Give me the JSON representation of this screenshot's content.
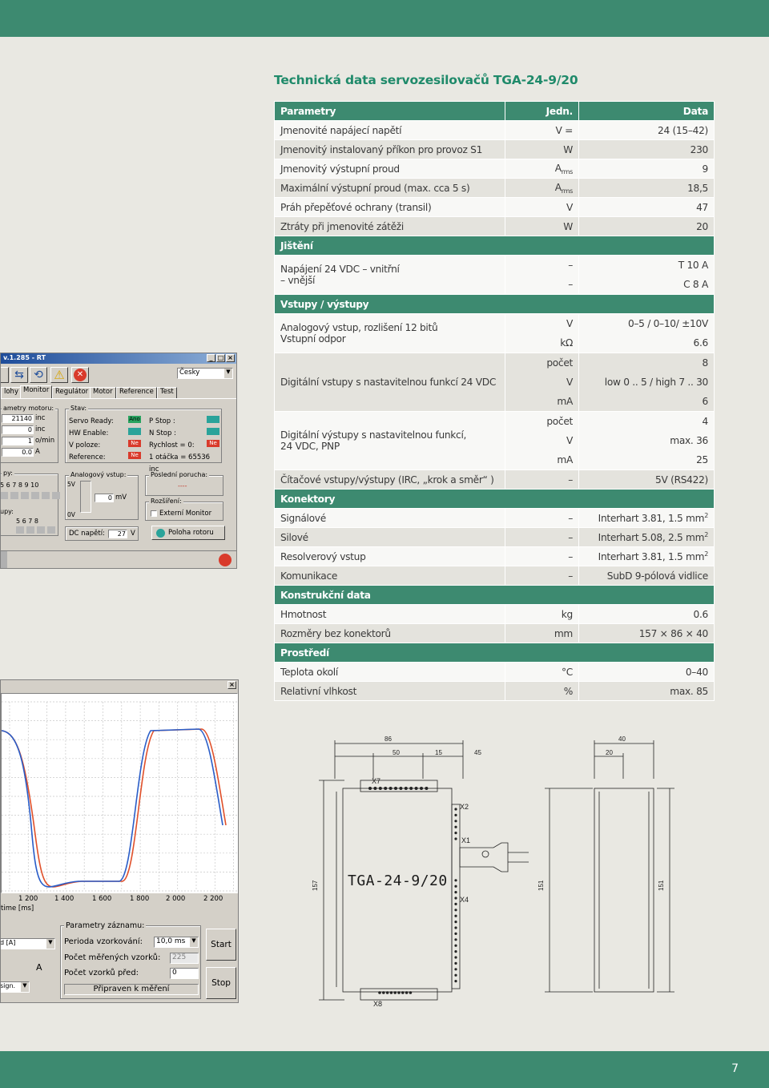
{
  "page": {
    "title": "Technická data servozesilovačů TGA-24-9/20",
    "page_number": "7",
    "colors": {
      "brand_green": "#3d8a70",
      "title_green": "#1f8a6a",
      "background": "#e9e8e2"
    }
  },
  "table": {
    "header": {
      "param": "Parametry",
      "unit": "Jedn.",
      "value": "Data"
    },
    "rows_power": [
      {
        "param": "Jmenovité napájecí napětí",
        "unit": "V =",
        "value": "24 (15–42)"
      },
      {
        "param": "Jmenovitý instalovaný příkon pro provoz S1",
        "unit": "W",
        "value": "230"
      },
      {
        "param": "Jmenovitý výstupní proud",
        "unit": "A",
        "unit_sub": "rms",
        "value": "9"
      },
      {
        "param": "Maximální výstupní proud (max. cca 5 s)",
        "unit": "A",
        "unit_sub": "rms",
        "value": "18,5"
      },
      {
        "param": "Práh přepěťové ochrany (transil)",
        "unit": "V",
        "value": "47"
      },
      {
        "param": "Ztráty při jmenovité zátěži",
        "unit": "W",
        "value": "20"
      }
    ],
    "sec_protection": "Jištění",
    "protection": {
      "param_line1": "Napájení 24 VDC – vnitřní",
      "param_line2": "– vnější",
      "unit1": "–",
      "value1": "T 10 A",
      "unit2": "–",
      "value2": "C 8 A"
    },
    "sec_io": "Vstupy / výstupy",
    "io_analog": {
      "param_line1": "Analogový vstup, rozlišení 12 bitů",
      "param_line2": "Vstupní odpor",
      "unit1": "V",
      "value1": "0–5 / 0–10/ ±10V",
      "unit2": "kΩ",
      "value2": "6.6"
    },
    "io_digital_in": {
      "param": "Digitální vstupy s nastavitelnou funkcí 24 VDC",
      "unit1": "počet",
      "value1": "8",
      "unit2": "V",
      "value2": "low 0 .. 5 / high 7 .. 30",
      "unit3": "mA",
      "value3": "6"
    },
    "io_digital_out": {
      "param_line1": "Digitální výstupy s nastavitelnou funkcí,",
      "param_line2": "24 VDC, PNP",
      "unit1": "počet",
      "value1": "4",
      "unit2": "V",
      "value2": "max. 36",
      "unit3": "mA",
      "value3": "25"
    },
    "io_counter": {
      "param": "Čítačové vstupy/výstupy (IRC, „krok a směr“ )",
      "unit": "–",
      "value": "5V (RS422)"
    },
    "sec_connectors": "Konektory",
    "connectors": [
      {
        "param": "Signálové",
        "unit": "–",
        "value": "Interhart 3.81, 1.5 mm",
        "sup": "2"
      },
      {
        "param": "Silové",
        "unit": "–",
        "value": "Interhart 5.08, 2.5 mm",
        "sup": "2"
      },
      {
        "param": "Resolverový vstup",
        "unit": "–",
        "value": "Interhart 3.81, 1.5 mm",
        "sup": "2"
      },
      {
        "param": "Komunikace",
        "unit": "–",
        "value": "SubD 9-pólová vidlice"
      }
    ],
    "sec_construction": "Konstrukční data",
    "construction": [
      {
        "param": "Hmotnost",
        "unit": "kg",
        "value": "0.6"
      },
      {
        "param": "Rozměry bez konektorů",
        "unit": "mm",
        "value": "157 × 86 × 40"
      }
    ],
    "sec_environment": "Prostředí",
    "environment": [
      {
        "param": "Teplota okolí",
        "unit": "°C",
        "value": "0–40"
      },
      {
        "param": "Relativní vlhkost",
        "unit": "%",
        "value": "max. 85"
      }
    ]
  },
  "software1": {
    "title": "v.1.285 - RT",
    "language": "Česky",
    "tabs": [
      "lohy",
      "Monitor",
      "Regulátor",
      "Motor",
      "Reference",
      "Test"
    ],
    "params_group": "ametry motoru:",
    "params": [
      {
        "value": "21140",
        "unit": "inc"
      },
      {
        "value": "0",
        "unit": "inc"
      },
      {
        "value": "1",
        "unit": "o/min"
      },
      {
        "value": "0.0",
        "unit": "A"
      }
    ],
    "status_group": "Stav:",
    "status_left": [
      {
        "label": "Servo Ready:",
        "led": "Ano"
      },
      {
        "label": "HW Enable:",
        "led": ""
      },
      {
        "label": "V poloze:",
        "led": "Ne"
      },
      {
        "label": "Reference:",
        "led": "Ne"
      }
    ],
    "status_right": [
      {
        "label": "P Stop :",
        "led": ""
      },
      {
        "label": "N Stop :",
        "led": ""
      },
      {
        "label": "Rychlost = 0:",
        "led": "Ne"
      },
      {
        "label": "1 otáčka = 65536 inc",
        "led": ""
      }
    ],
    "inputs_group": "py:",
    "inputs_numbers": "5 6 7 8 9 10",
    "outputs_group": "upy:",
    "outputs_numbers": "5 6 7 8",
    "analog_group": "Analogový vstup:",
    "analog_top": "5V",
    "analog_bottom": "0V",
    "analog_value": "0",
    "analog_unit": "mV",
    "fault_group": "Poslední porucha:",
    "fault_value": "----",
    "ext_group": "Rozšíření:",
    "ext_monitor": "Externí Monitor",
    "dc_label": "DC napětí:",
    "dc_value": "27",
    "dc_unit": "V",
    "rotor_button": "Poloha rotoru"
  },
  "software2": {
    "x_ticks": [
      "1 200",
      "1 400",
      "1 600",
      "1 800",
      "2 000",
      "2 200"
    ],
    "x_label": "time [ms]",
    "rec_group": "Parametry záznamu:",
    "period_label": "Perioda vzorkování:",
    "period_value": "10,0 ms",
    "count_label": "Počet měřených vzorků:",
    "count_value": "225",
    "pre_label": "Počet vzorků před:",
    "pre_value": "0",
    "ready_label": "Připraven k měření",
    "start_button": "Start",
    "stop_button": "Stop",
    "channel_label": "d [A]",
    "channel_unit": "A",
    "sign_label": "sign."
  },
  "drawing": {
    "dim_86": "86",
    "dim_50": "50",
    "dim_15": "15",
    "dim_45": "45",
    "dim_40": "40",
    "dim_20": "20",
    "dim_157": "157",
    "dim_151a": "151",
    "dim_151b": "151",
    "x7": "X7",
    "x2": "X2",
    "x1": "X1",
    "x4": "X4",
    "x8": "X8",
    "product": "TGA-24-9/20"
  }
}
